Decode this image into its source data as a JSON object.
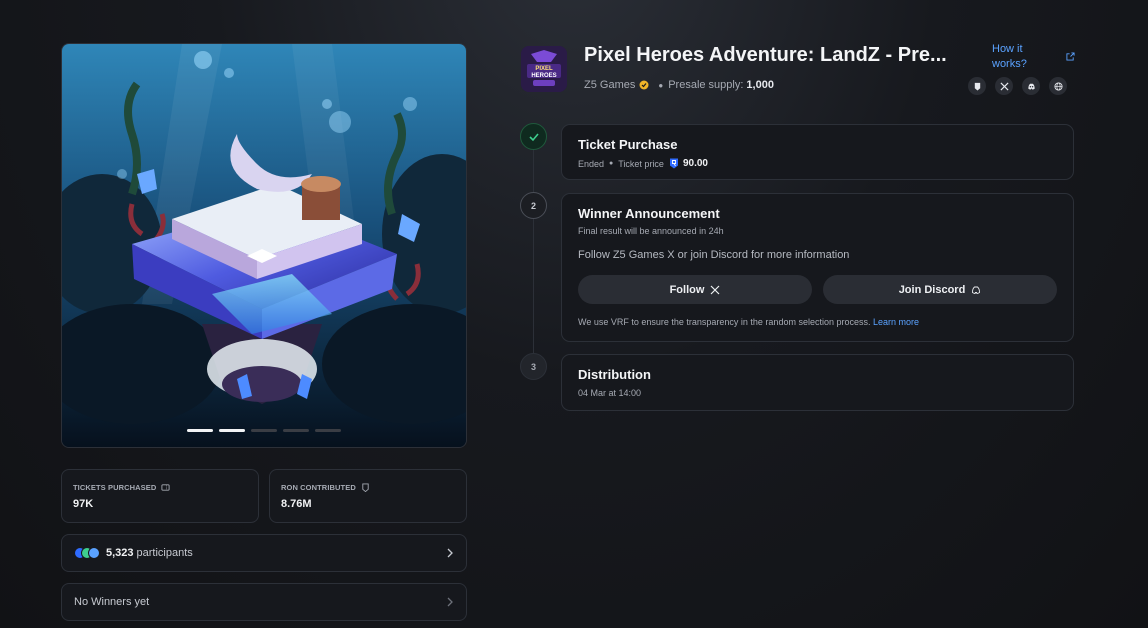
{
  "project": {
    "title": "Pixel Heroes Adventure: LandZ - Pre...",
    "logo_text": "PIXEL HEROES",
    "how_it_works": "How it works?",
    "publisher": "Z5 Games",
    "supply_label": "Presale supply:",
    "supply_value": "1,000",
    "socials": [
      "ronin-icon",
      "x-icon",
      "discord-icon",
      "globe-icon"
    ]
  },
  "gallery": {
    "slides": 5,
    "active": [
      0,
      1
    ]
  },
  "stats": {
    "tickets_label": "TICKETS PURCHASED",
    "tickets_value": "97K",
    "ron_label": "RON CONTRIBUTED",
    "ron_value": "8.76M"
  },
  "participants": {
    "count": "5,323",
    "label": "participants"
  },
  "winners": {
    "label": "No Winners yet"
  },
  "steps": {
    "purchase": {
      "title": "Ticket Purchase",
      "status": "Ended",
      "price_label": "Ticket price",
      "price_value": "90.00"
    },
    "announcement": {
      "number": "2",
      "title": "Winner Announcement",
      "subtitle": "Final result will be announced in 24h",
      "text": "Follow Z5 Games X or join Discord for more information",
      "follow_label": "Follow",
      "discord_label": "Join Discord",
      "note": "We use VRF to ensure the transparency in the random selection process.",
      "learn_more": "Learn more"
    },
    "distribution": {
      "number": "3",
      "title": "Distribution",
      "date": "04 Mar at 14:00"
    }
  },
  "colors": {
    "accent": "#5aa2ff",
    "success": "#3ecf8e",
    "card_bg": "#16181d",
    "border": "#2c3038"
  }
}
